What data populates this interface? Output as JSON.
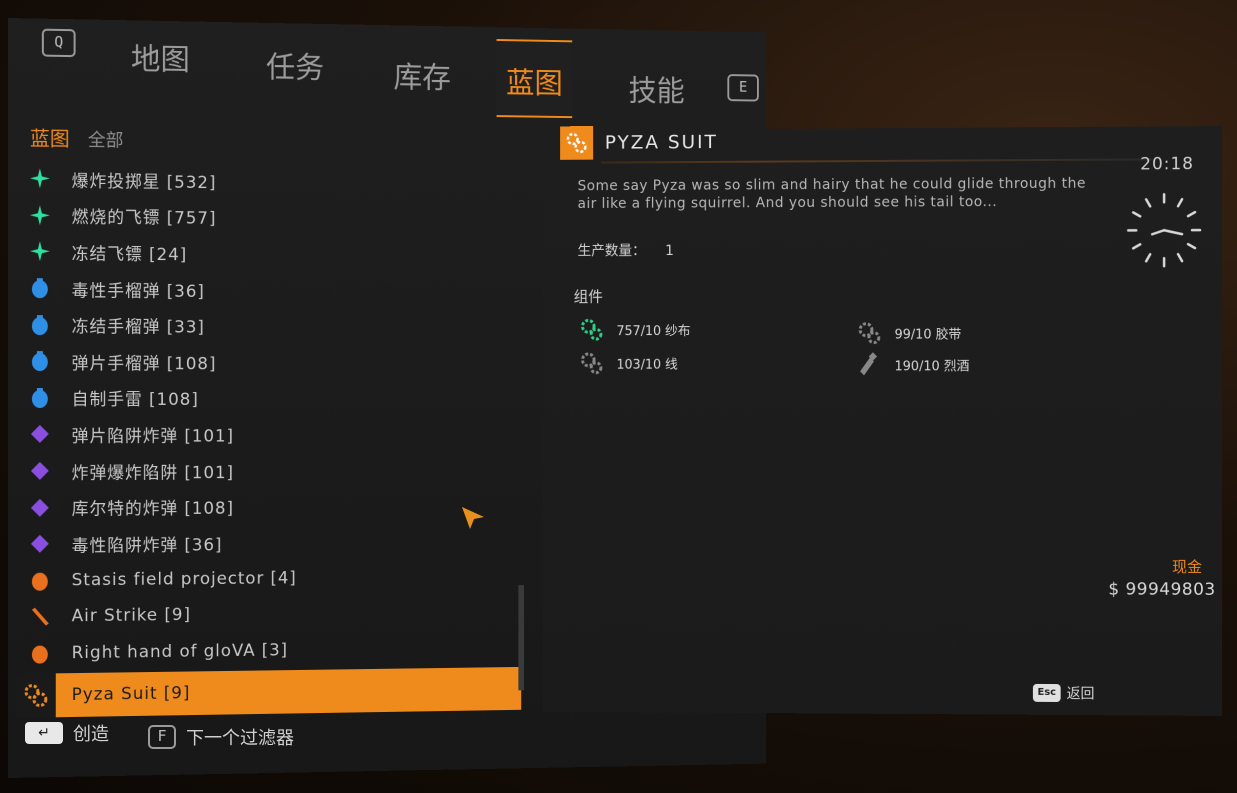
{
  "tabs": {
    "prev_key": "Q",
    "next_key": "E",
    "items": [
      {
        "label": "地图"
      },
      {
        "label": "任务"
      },
      {
        "label": "库存"
      },
      {
        "label": "蓝图"
      },
      {
        "label": "技能"
      }
    ],
    "active": "蓝图"
  },
  "filter": {
    "category": "蓝图",
    "scope": "全部"
  },
  "blueprints": [
    {
      "label": "爆炸投掷星 [532]",
      "icon": "star-icon"
    },
    {
      "label": "燃烧的飞镖 [757]",
      "icon": "star-icon"
    },
    {
      "label": "冻结飞镖 [24]",
      "icon": "star-icon"
    },
    {
      "label": "毒性手榴弹 [36]",
      "icon": "grenade-icon"
    },
    {
      "label": "冻结手榴弹 [33]",
      "icon": "grenade-icon"
    },
    {
      "label": "弹片手榴弹 [108]",
      "icon": "grenade-icon"
    },
    {
      "label": "自制手雷 [108]",
      "icon": "grenade-icon"
    },
    {
      "label": "弹片陷阱炸弹 [101]",
      "icon": "trap-icon"
    },
    {
      "label": "炸弹爆炸陷阱 [101]",
      "icon": "trap-icon"
    },
    {
      "label": "库尔特的炸弹 [108]",
      "icon": "trap-icon"
    },
    {
      "label": "毒性陷阱炸弹 [36]",
      "icon": "trap-icon"
    },
    {
      "label": "Stasis field projector  [4]",
      "icon": "projector-icon"
    },
    {
      "label": "Air Strike  [9]",
      "icon": "flare-icon"
    },
    {
      "label": "Right hand of gloVA  [3]",
      "icon": "projector-icon"
    },
    {
      "label": "Pyza Suit [9]",
      "icon": "gears-icon",
      "selected": true
    }
  ],
  "footer": {
    "create_key": "↵",
    "create_label": "创造",
    "filter_key": "F",
    "filter_label": "下一个过滤器"
  },
  "detail": {
    "title": "PYZA SUIT",
    "description": "Some say Pyza was so slim and hairy that he could glide through the air like a flying squirrel. And you should see his tail too...",
    "qty_label": "生产数量：",
    "qty_value": "1",
    "components_label": "组件",
    "materials": [
      {
        "text": "757/10 纱布",
        "icon": "gear-icon"
      },
      {
        "text": "99/10 胶带",
        "icon": "gear-icon"
      },
      {
        "text": "103/10 线",
        "icon": "gear-icon"
      },
      {
        "text": "190/10 烈酒",
        "icon": "flask-icon"
      }
    ]
  },
  "clock": {
    "time": "20:18"
  },
  "cash": {
    "label": "现金",
    "value": "$ 99949803"
  },
  "back": {
    "key": "Esc",
    "label": "返回"
  },
  "colors": {
    "accent": "#ef8a1d",
    "star": "#2fe0a0",
    "grenade": "#2f8fe6",
    "trap": "#8a4fe0",
    "orange_item": "#e8701e"
  }
}
